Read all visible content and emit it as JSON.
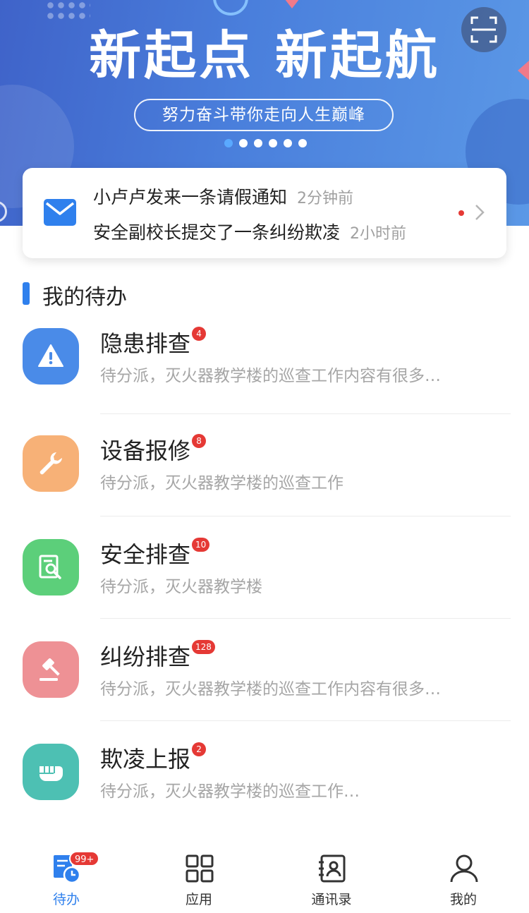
{
  "banner": {
    "title": "新起点  新起航",
    "slogan": "努力奋斗带你走向人生巅峰",
    "slide_count": 6,
    "active_slide": 0
  },
  "scan_icon": "scan-icon",
  "notifications": {
    "icon": "mail-icon",
    "items": [
      {
        "text": "小卢卢发来一条请假通知",
        "time": "2分钟前"
      },
      {
        "text": "安全副校长提交了一条纠纷欺凌",
        "time": "2小时前"
      }
    ]
  },
  "section": {
    "title": "我的待办"
  },
  "todos": [
    {
      "title": "隐患排查",
      "badge": "4",
      "desc": "待分派，灭火器教学楼的巡查工作内容有很多…",
      "icon": "warning-icon",
      "color": "#4a8be8"
    },
    {
      "title": "设备报修",
      "badge": "8",
      "desc": "待分派，灭火器教学楼的巡查工作",
      "icon": "wrench-icon",
      "color": "#f7b177"
    },
    {
      "title": "安全排查",
      "badge": "10",
      "desc": "待分派，灭火器教学楼",
      "icon": "document-search-icon",
      "color": "#5ccf7a"
    },
    {
      "title": "纠纷排查",
      "badge": "128",
      "desc": "待分派，灭火器教学楼的巡查工作内容有很多…",
      "icon": "gavel-icon",
      "color": "#ee9195"
    },
    {
      "title": "欺凌上报",
      "badge": "2",
      "desc": "待分派，灭火器教学楼的巡查工作…",
      "icon": "fist-icon",
      "color": "#4dc0b3"
    }
  ],
  "tabbar": {
    "items": [
      {
        "label": "待办",
        "icon": "todo-clock-icon",
        "badge": "99+",
        "active": true
      },
      {
        "label": "应用",
        "icon": "grid-apps-icon",
        "active": false
      },
      {
        "label": "通讯录",
        "icon": "contacts-book-icon",
        "active": false
      },
      {
        "label": "我的",
        "icon": "person-icon",
        "active": false
      }
    ]
  },
  "colors": {
    "accent": "#2f80ed",
    "badge": "#e53935"
  }
}
